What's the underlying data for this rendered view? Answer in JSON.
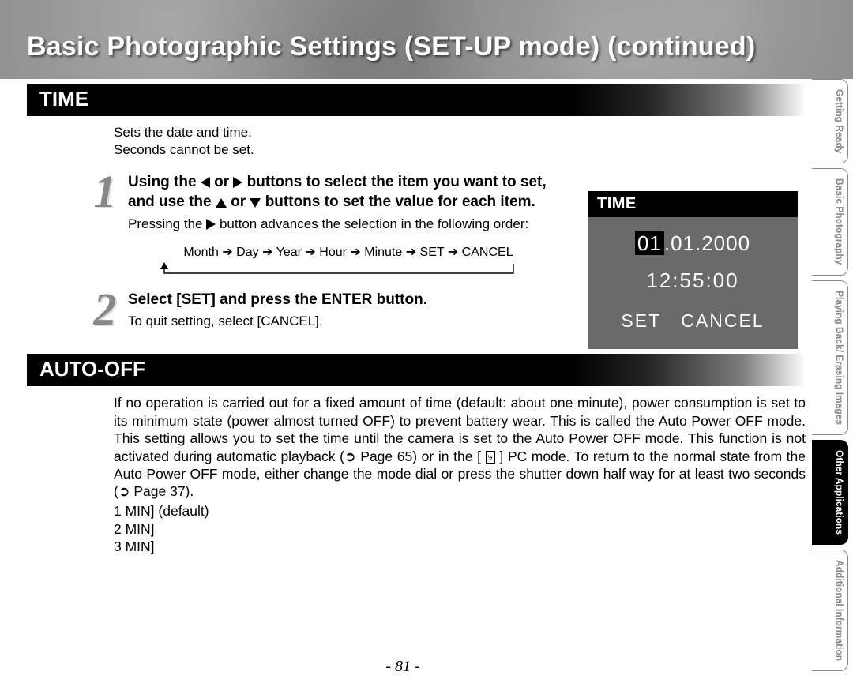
{
  "page": {
    "title": "Basic Photographic Settings (SET-UP mode) (continued)",
    "number": "- 81 -"
  },
  "tabs": [
    {
      "label": "Getting Ready",
      "active": false
    },
    {
      "label": "Basic Photography",
      "active": false
    },
    {
      "label": "Playing Back/ Erasing Images",
      "active": false
    },
    {
      "label": "Other Applications",
      "active": true
    },
    {
      "label": "Additional Information",
      "active": false
    }
  ],
  "time_section": {
    "heading": "TIME",
    "intro_line1": "Sets the date and time.",
    "intro_line2": "Seconds cannot be set.",
    "step1": {
      "num": "1",
      "title_pre": "Using the ",
      "title_mid1": " or ",
      "title_mid2": " buttons to select the item you want to set, and use the ",
      "title_mid3": " or ",
      "title_post": " buttons to set the value for each item.",
      "note_pre": "Pressing the ",
      "note_post": " button advances the selection in the following order:",
      "order": "Month ➔ Day ➔ Year  ➔ Hour ➔ Minute ➔ SET ➔ CANCEL"
    },
    "step2": {
      "num": "2",
      "title": "Select [SET] and press the ENTER button.",
      "note": "To quit setting, select [CANCEL]."
    },
    "lcd": {
      "title": "TIME",
      "date_hl": "01",
      "date_rest": ".01.2000",
      "time": "12:55:00",
      "set": "SET",
      "cancel": "CANCEL"
    }
  },
  "autooff_section": {
    "heading": "AUTO-OFF",
    "para_pre": "If no operation is carried out for a fixed amount of time (default: about one minute), power consumption is set to its minimum state (power almost turned OFF) to prevent battery wear. This is called the Auto Power OFF mode. This setting allows you to set the time until the camera is set to the Auto Power OFF mode. This function is not activated during automatic playback (",
    "page_ref1": " Page 65) or in the [ ",
    "para_mid": " ] PC mode. To return to the normal state from the Auto Power OFF mode, either change the mode dial or press the shutter down half way for at least two seconds (",
    "page_ref2": " Page 37).",
    "opt1": "1 MIN] (default)",
    "opt2": "2 MIN]",
    "opt3": "3 MIN]"
  }
}
